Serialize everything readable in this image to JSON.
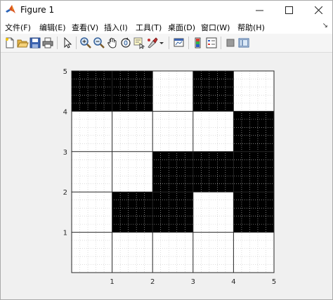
{
  "window": {
    "title": "Figure 1",
    "min_glyph": "—",
    "close_glyph": "✕"
  },
  "menu": {
    "items": [
      {
        "label": "文件(F)"
      },
      {
        "label": "编辑(E)"
      },
      {
        "label": "查看(V)"
      },
      {
        "label": "插入(I)"
      },
      {
        "label": "工具(T)"
      },
      {
        "label": "桌面(D)"
      },
      {
        "label": "窗口(W)"
      },
      {
        "label": "帮助(H)"
      }
    ],
    "overflow_glyph": "↘"
  },
  "toolbar": {
    "buttons": [
      {
        "icon": "new-figure-icon"
      },
      {
        "icon": "open-file-icon"
      },
      {
        "icon": "save-icon"
      },
      {
        "icon": "print-icon"
      },
      {
        "icon": "pointer-icon"
      },
      {
        "icon": "zoom-in-icon"
      },
      {
        "icon": "zoom-out-icon"
      },
      {
        "icon": "pan-icon"
      },
      {
        "icon": "rotate-3d-icon"
      },
      {
        "icon": "data-cursor-icon"
      },
      {
        "icon": "brush-icon"
      },
      {
        "icon": "link-plot-icon"
      },
      {
        "icon": "colorbar-icon"
      },
      {
        "icon": "legend-icon"
      },
      {
        "icon": "hide-plot-tools-icon"
      },
      {
        "icon": "show-plot-tools-icon"
      }
    ]
  },
  "chart_data": {
    "type": "heatmap",
    "title": "",
    "xlabel": "",
    "ylabel": "",
    "xlim": [
      0,
      5
    ],
    "ylim": [
      0,
      5
    ],
    "xticks": [
      "1",
      "2",
      "3",
      "4",
      "5"
    ],
    "yticks": [
      "1",
      "2",
      "3",
      "4",
      "5"
    ],
    "grid": "on",
    "minor_grid": "on",
    "colors": {
      "filled": "#000000",
      "empty": "#ffffff"
    },
    "cells_filled": [
      [
        0,
        4
      ],
      [
        1,
        4
      ],
      [
        3,
        4
      ],
      [
        4,
        3
      ],
      [
        2,
        2
      ],
      [
        3,
        2
      ],
      [
        4,
        2
      ],
      [
        1,
        1
      ],
      [
        2,
        1
      ],
      [
        4,
        1
      ]
    ]
  }
}
